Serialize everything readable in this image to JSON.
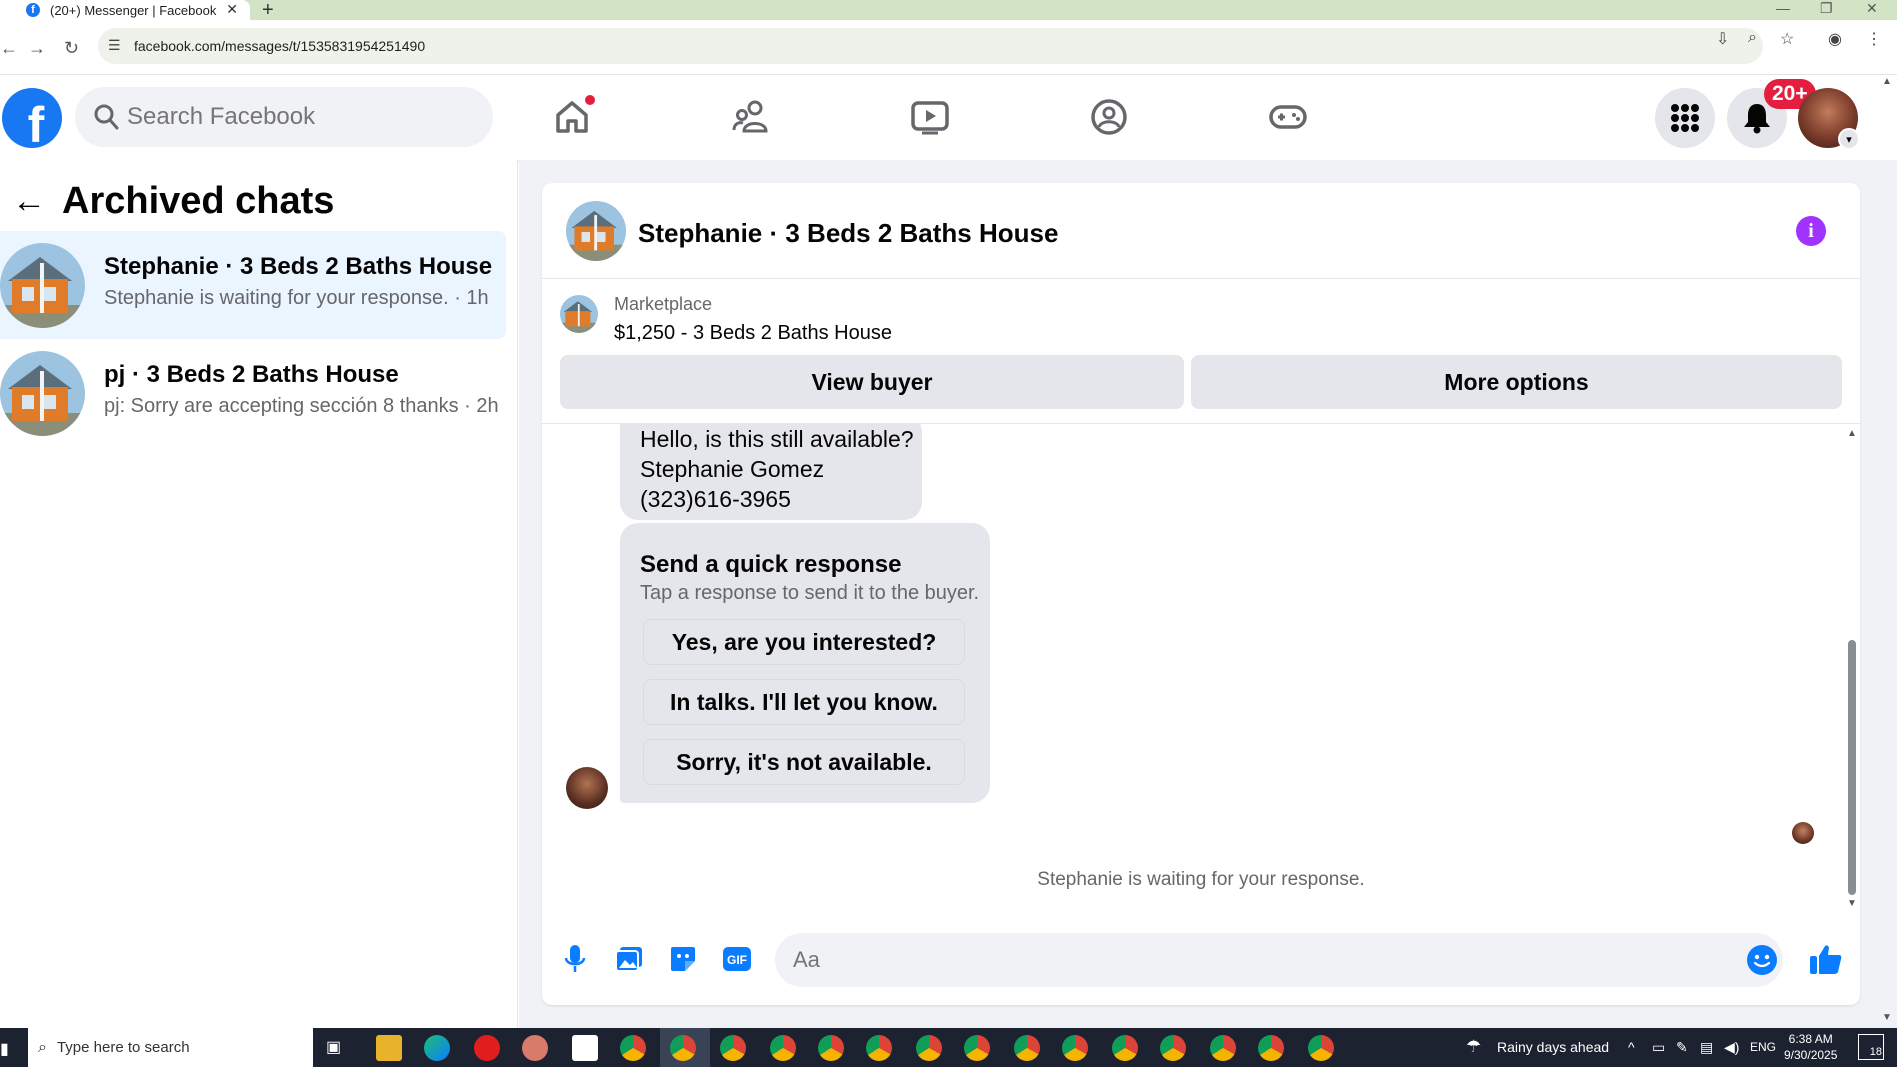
{
  "browser": {
    "tab_title": "(20+) Messenger | Facebook",
    "url": "facebook.com/messages/t/1535831954251490"
  },
  "facebook": {
    "search_placeholder": "Search Facebook",
    "notification_badge": "20+"
  },
  "sidebar": {
    "title": "Archived chats",
    "chats": [
      {
        "name": "Stephanie · 3 Beds 2 Baths House",
        "preview": "Stephanie is waiting for your response. · 1h",
        "active": true
      },
      {
        "name": "pj · 3 Beds 2 Baths House",
        "preview": "pj: Sorry are accepting sección 8 thanks · 2h",
        "active": false
      }
    ]
  },
  "conversation": {
    "title": "Stephanie · 3 Beds 2 Baths House",
    "listing_source": "Marketplace",
    "listing_title": "$1,250 - 3 Beds 2 Baths House",
    "view_buyer_label": "View buyer",
    "more_options_label": "More options",
    "message_lines": [
      "Hello, is this still available?",
      "Stephanie Gomez",
      "(323)616-3965"
    ],
    "quick_response": {
      "title": "Send a quick response",
      "subtitle": "Tap a response to send it to the buyer.",
      "options": [
        "Yes, are you interested?",
        "In talks. I'll let you know.",
        "Sorry, it's not available."
      ]
    },
    "waiting_text": "Stephanie is waiting for your response.",
    "composer_placeholder": "Aa"
  },
  "taskbar": {
    "search_placeholder": "Type here to search",
    "weather": "Rainy days ahead",
    "language": "ENG",
    "time": "6:38 AM",
    "date": "9/30/2025",
    "notification_count": "18"
  },
  "colors": {
    "fb_blue": "#1877f2",
    "messenger_blue": "#0a7cff",
    "info_purple": "#a033ff",
    "badge_red": "#e41e3f",
    "active_chat_bg": "#ebf5ff"
  }
}
